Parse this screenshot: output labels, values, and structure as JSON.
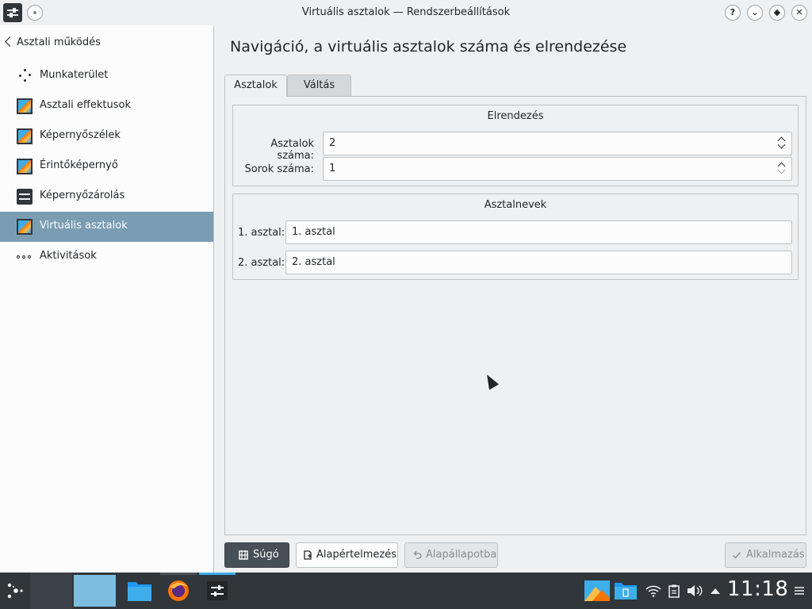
{
  "window": {
    "title": "Virtuális asztalok — Rendszerbeállítások",
    "buttons": [
      "?",
      "⌄",
      "◆",
      "✕"
    ]
  },
  "sidebar": {
    "back_label": "Asztali működés",
    "items": [
      {
        "label": "Munkaterület",
        "icon": "workspace-icon"
      },
      {
        "label": "Asztali effektusok",
        "icon": "desktop-effects-icon"
      },
      {
        "label": "Képernyőszélek",
        "icon": "screen-edges-icon"
      },
      {
        "label": "Érintőképernyő",
        "icon": "touchscreen-icon"
      },
      {
        "label": "Képernyőzárolás",
        "icon": "screen-lock-icon"
      },
      {
        "label": "Virtuális asztalok",
        "icon": "virtual-desktops-icon",
        "selected": true
      },
      {
        "label": "Aktivitások",
        "icon": "activities-icon"
      }
    ]
  },
  "main": {
    "title": "Navigáció, a virtuális asztalok száma és elrendezése",
    "tabs": [
      {
        "label": "Asztalok",
        "active": true
      },
      {
        "label": "Váltás",
        "active": false
      }
    ],
    "layout_group": {
      "title": "Elrendezés",
      "desktop_count_label": "Asztalok száma:",
      "desktop_count_value": "2",
      "rows_label": "Sorok száma:",
      "rows_value": "1"
    },
    "names_group": {
      "title": "Asztalnevek",
      "desktops": [
        {
          "label": "1. asztal:",
          "value": "1. asztal"
        },
        {
          "label": "2. asztal:",
          "value": "2. asztal"
        }
      ]
    }
  },
  "buttons": {
    "help": "Súgó",
    "defaults": "Alapértelmezés",
    "reset": "Alapállapotba",
    "apply": "Alkalmazás"
  },
  "taskbar": {
    "clock": "11:18"
  },
  "colors": {
    "accent": "#3daee9",
    "selection": "#7a9db3",
    "taskbar": "#31363b",
    "window_bg": "#eff0f1"
  }
}
